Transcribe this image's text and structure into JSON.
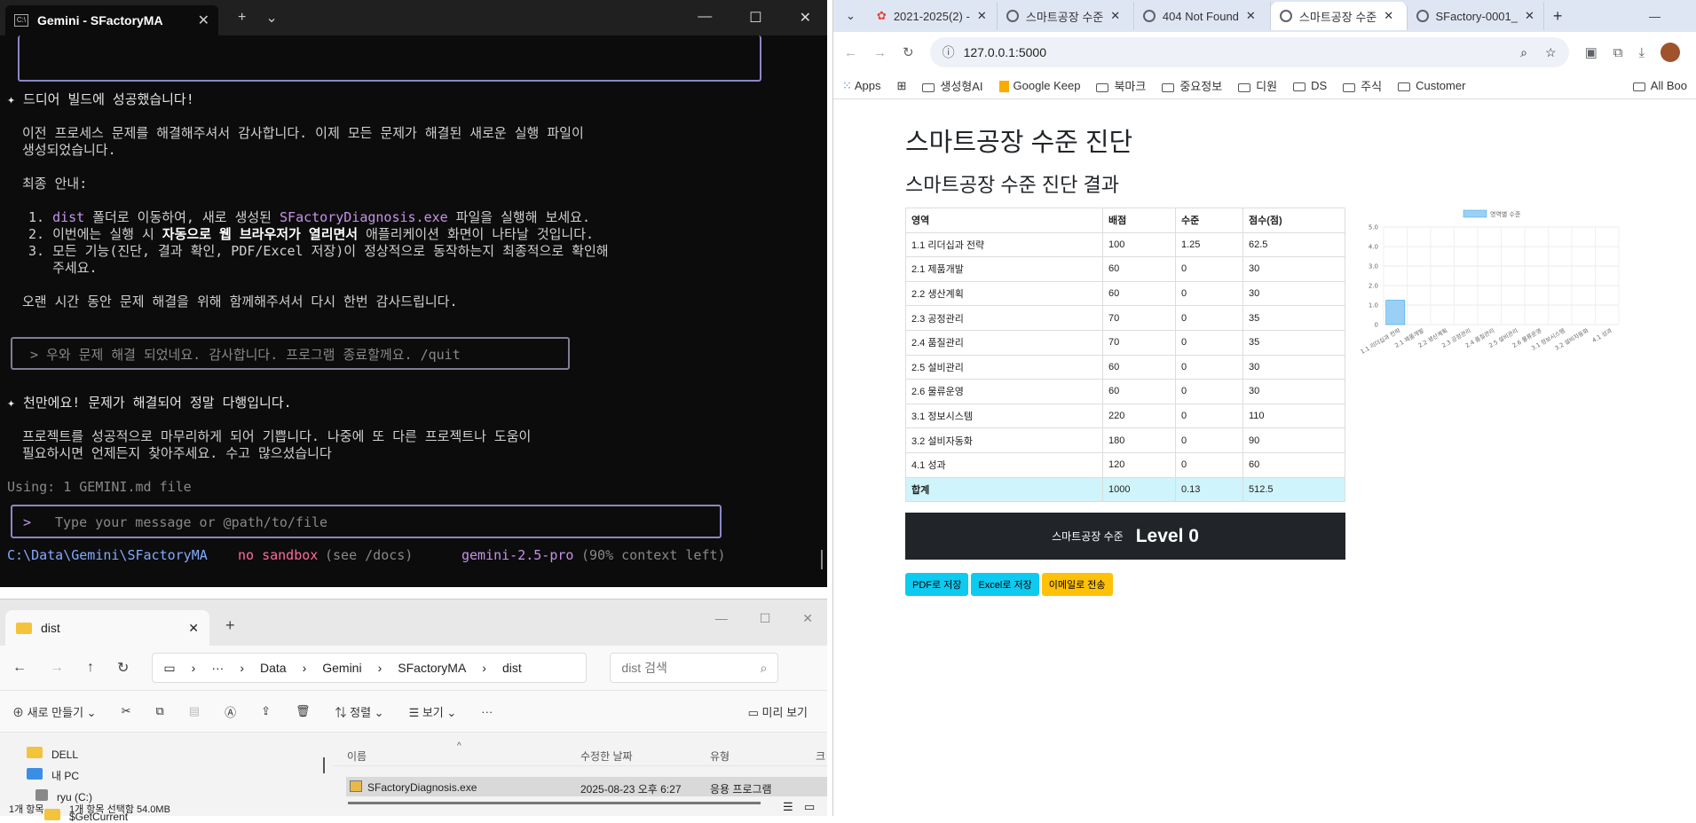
{
  "terminal": {
    "tab_title": "Gemini - SFactoryMA",
    "line1": "✦ 드디어 빌드에 성공했습니다!",
    "line2": "이전 프로세스 문제를 해결해주셔서 감사합니다. 이제 모든 문제가 해결된 새로운 실행 파일이",
    "line3": "생성되었습니다.",
    "line4": "최종 안내:",
    "s1a": "1. ",
    "s1b": "dist",
    "s1c": " 폴더로 이동하여, 새로 생성된 ",
    "s1d": "SFactoryDiagnosis.exe",
    "s1e": " 파일을 실행해 보세요.",
    "s2a": "2. 이번에는 실행 시 ",
    "s2b": "자동으로 웹 브라우저가 열리면서",
    "s2c": " 애플리케이션 화면이 나타날 것입니다.",
    "s3": "3. 모든 기능(진단, 결과 확인, PDF/Excel 저장)이 정상적으로 동작하는지 최종적으로 확인해",
    "s3b": "   주세요.",
    "line5": "오랜 시간 동안 문제 해결을 위해 함께해주셔서 다시 한번 감사드립니다.",
    "user_msg": "> 우와 문제 해결 되었네요. 감사합니다. 프로그램 종료할께요. /quit",
    "line6": "✦ 천만에요! 문제가 해결되어 정말 다행입니다.",
    "line7": "프로젝트를 성공적으로 마무리하게 되어 기쁩니다. 나중에 또 다른 프로젝트나 도움이",
    "line8": "필요하시면 언제든지 찾아주세요. 수고 많으셨습니다",
    "using": "Using: 1 GEMINI.md file",
    "input_prompt": ">",
    "input_placeholder": "Type your message or @path/to/file",
    "path": "C:\\Data\\Gemini\\SFactoryMA",
    "sandbox": "no sandbox",
    "sandbox_hint": "(see /docs)",
    "model": "gemini-2.5-pro",
    "context": "(90% context left)"
  },
  "explorer": {
    "tab_title": "dist",
    "breadcrumb": [
      "Data",
      "Gemini",
      "SFactoryMA",
      "dist"
    ],
    "search_placeholder": "dist 검색",
    "new_label": "새로 만들기",
    "sort_label": "정렬",
    "view_label": "보기",
    "preview_label": "미리 보기",
    "nav": [
      "DELL",
      "내 PC",
      "ryu (C:)",
      "$GetCurrent"
    ],
    "headers": [
      "이름",
      "수정한 날짜",
      "유형",
      "크"
    ],
    "file": {
      "name": "SFactoryDiagnosis.exe",
      "date": "2025-08-23 오후 6:27",
      "type": "응용 프로그램"
    },
    "status_count": "1개 항목",
    "status_selected": "1개 항목 선택함 54.0MB"
  },
  "browser": {
    "tabs": [
      "2021-2025(2) -",
      "스마트공장 수준",
      "404 Not Found",
      "스마트공장 수준",
      "SFactory-0001_"
    ],
    "url": "127.0.0.1:5000",
    "bookmarks": [
      "Apps",
      "생성형AI",
      "Google Keep",
      "북마크",
      "중요정보",
      "디원",
      "DS",
      "주식",
      "Customer",
      "All Boo"
    ],
    "page_title": "스마트공장 수준 진단",
    "subtitle": "스마트공장 수준 진단 결과",
    "table_headers": [
      "영역",
      "배점",
      "수준",
      "점수(점)"
    ],
    "rows": [
      [
        "1.1 리더십과 전략",
        "100",
        "1.25",
        "62.5"
      ],
      [
        "2.1 제품개발",
        "60",
        "0",
        "30"
      ],
      [
        "2.2 생산계획",
        "60",
        "0",
        "30"
      ],
      [
        "2.3 공정관리",
        "70",
        "0",
        "35"
      ],
      [
        "2.4 품질관리",
        "70",
        "0",
        "35"
      ],
      [
        "2.5 설비관리",
        "60",
        "0",
        "30"
      ],
      [
        "2.6 물류운영",
        "60",
        "0",
        "30"
      ],
      [
        "3.1 정보시스템",
        "220",
        "0",
        "110"
      ],
      [
        "3.2 설비자동화",
        "180",
        "0",
        "90"
      ],
      [
        "4.1 성과",
        "120",
        "0",
        "60"
      ]
    ],
    "total": [
      "합계",
      "1000",
      "0.13",
      "512.5"
    ],
    "level_label": "스마트공장 수준",
    "level_value": "Level 0",
    "buttons": {
      "pdf": "PDF로 저장",
      "excel": "Excel로 저장",
      "email": "이메일로 전송"
    },
    "colors": {
      "pdf": "#0dcaf0",
      "excel": "#0dcaf0",
      "email": "#ffc107",
      "level_bg": "#212529",
      "total_bg": "#cff4fc"
    }
  },
  "chart_data": {
    "type": "bar",
    "categories": [
      "1.1 리더십과 전략",
      "2.1 제품개발",
      "2.2 생산계획",
      "2.3 공정관리",
      "2.4 품질관리",
      "2.5 설비관리",
      "2.6 물류운영",
      "3.1 정보시스템",
      "3.2 설비자동화",
      "4.1 성과"
    ],
    "series": [
      {
        "name": "영역별 수준",
        "values": [
          1.25,
          0,
          0,
          0,
          0,
          0,
          0,
          0,
          0,
          0
        ]
      }
    ],
    "yticks": [
      "5.0",
      "4.0",
      "3.0",
      "2.0",
      "1.0",
      "0"
    ],
    "ylim": [
      0,
      5
    ],
    "legend": "top-center",
    "color": "#9ad0f5"
  }
}
